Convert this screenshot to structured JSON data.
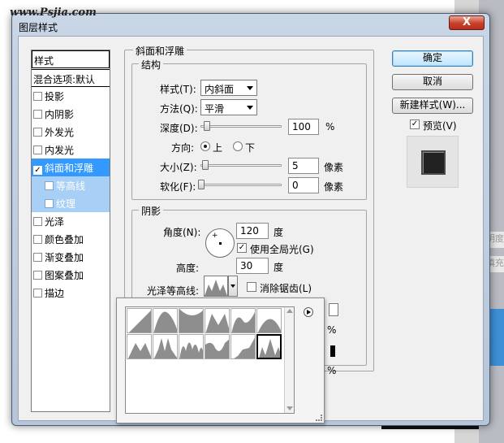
{
  "watermark": "www.Psjia.com",
  "dialog": {
    "title": "图层样式",
    "close_symbol": "X"
  },
  "styles": {
    "header": "样式",
    "blend_options": "混合选项:默认",
    "items": [
      {
        "label": "投影",
        "checked": false,
        "state": "normal"
      },
      {
        "label": "内阴影",
        "checked": false,
        "state": "normal"
      },
      {
        "label": "外发光",
        "checked": false,
        "state": "normal"
      },
      {
        "label": "内发光",
        "checked": false,
        "state": "normal"
      },
      {
        "label": "斜面和浮雕",
        "checked": true,
        "state": "selected"
      },
      {
        "label": "等高线",
        "checked": false,
        "state": "sub"
      },
      {
        "label": "纹理",
        "checked": false,
        "state": "sub"
      },
      {
        "label": "光泽",
        "checked": false,
        "state": "normal"
      },
      {
        "label": "颜色叠加",
        "checked": false,
        "state": "normal"
      },
      {
        "label": "渐变叠加",
        "checked": false,
        "state": "normal"
      },
      {
        "label": "图案叠加",
        "checked": false,
        "state": "normal"
      },
      {
        "label": "描边",
        "checked": false,
        "state": "normal"
      }
    ]
  },
  "bevel": {
    "section_title": "斜面和浮雕",
    "structure_title": "结构",
    "style_label": "样式(T):",
    "style_value": "内斜面",
    "technique_label": "方法(Q):",
    "technique_value": "平滑",
    "depth_label": "深度(D):",
    "depth_value": "100",
    "depth_unit": "%",
    "direction_label": "方向:",
    "direction_up": "上",
    "direction_down": "下",
    "size_label": "大小(Z):",
    "size_value": "5",
    "size_unit": "像素",
    "soften_label": "软化(F):",
    "soften_value": "0",
    "soften_unit": "像素"
  },
  "shading": {
    "title": "阴影",
    "angle_label": "角度(N):",
    "angle_value": "120",
    "angle_unit": "度",
    "global_light_label": "使用全局光(G)",
    "global_light_checked": true,
    "altitude_label": "高度:",
    "altitude_value": "30",
    "altitude_unit": "度",
    "gloss_contour_label": "光泽等高线:",
    "anti_alias_label": "消除锯齿(L)",
    "anti_alias_checked": false,
    "hidden_unit_1": "%",
    "hidden_unit_2": "%"
  },
  "buttons": {
    "ok": "确定",
    "cancel": "取消",
    "new_style": "新建样式(W)...",
    "preview_label": "预览(V)",
    "preview_checked": true
  },
  "colors": {
    "selected": "#3399ff",
    "sub_selected": "#a8cff5",
    "close_red": "#c8402a"
  }
}
